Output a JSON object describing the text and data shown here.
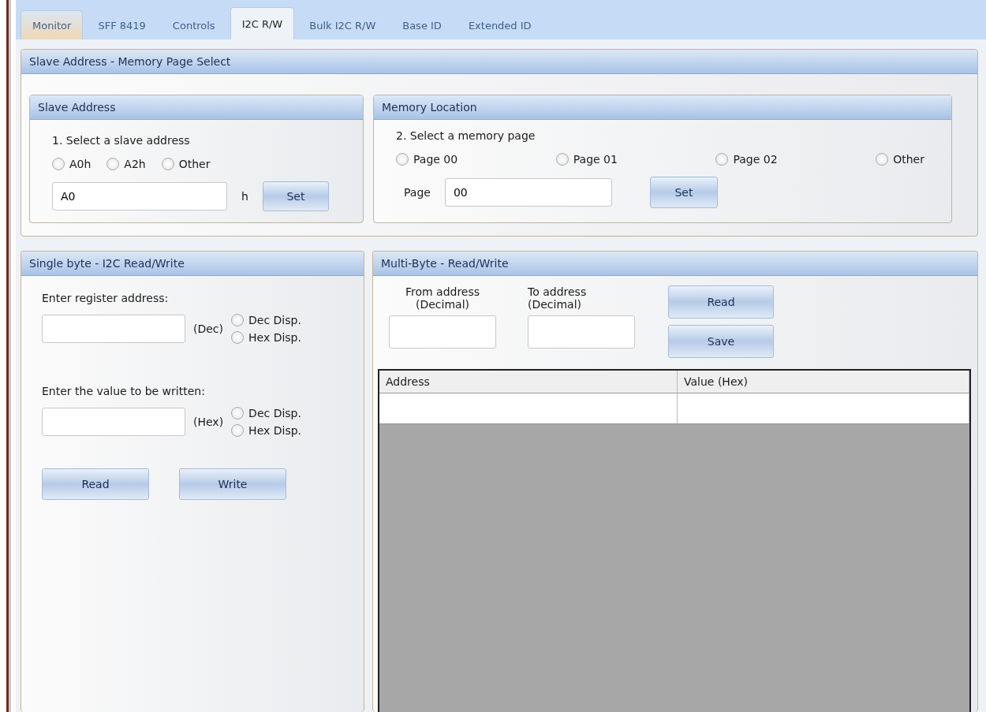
{
  "tabs": [
    {
      "label": "Monitor",
      "selected": false,
      "hovered": true
    },
    {
      "label": "SFF 8419",
      "selected": false,
      "hovered": false
    },
    {
      "label": "Controls",
      "selected": false,
      "hovered": false
    },
    {
      "label": "I2C R/W",
      "selected": true,
      "hovered": false
    },
    {
      "label": "Bulk I2C R/W",
      "selected": false,
      "hovered": false
    },
    {
      "label": "Base ID",
      "selected": false,
      "hovered": false
    },
    {
      "label": "Extended ID",
      "selected": false,
      "hovered": false
    }
  ],
  "main_group": {
    "title": "Slave Address - Memory Page Select",
    "slave_address": {
      "title": "Slave Address",
      "instruction": "1. Select a slave address",
      "options": [
        {
          "label": "A0h",
          "checked": false
        },
        {
          "label": "A2h",
          "checked": false
        },
        {
          "label": "Other",
          "checked": false
        }
      ],
      "value": "A0",
      "suffix": "h",
      "button": "Set"
    },
    "memory_location": {
      "title": "Memory Location",
      "instruction": "2. Select a memory page",
      "options": [
        {
          "label": "Page 00",
          "checked": false
        },
        {
          "label": "Page 01",
          "checked": false
        },
        {
          "label": "Page 02",
          "checked": false
        },
        {
          "label": "Other",
          "checked": false
        }
      ],
      "field_label": "Page",
      "value": "00",
      "button": "Set"
    }
  },
  "single_byte": {
    "title": "Single byte - I2C Read/Write",
    "sections": [
      {
        "label": "Enter register address:",
        "unit": "(Dec)",
        "options": [
          {
            "label": "Dec Disp.",
            "checked": false
          },
          {
            "label": "Hex Disp.",
            "checked": false
          }
        ]
      },
      {
        "label": "Enter the value to be written:",
        "unit": "(Hex)",
        "options": [
          {
            "label": "Dec Disp.",
            "checked": false
          },
          {
            "label": "Hex Disp.",
            "checked": false
          }
        ]
      }
    ],
    "buttons": [
      "Read",
      "Write"
    ]
  },
  "multi_byte": {
    "title": "Multi-Byte - Read/Write",
    "from_label": "From address\n(Decimal)",
    "to_label": "To address\n(Decimal)",
    "buttons": [
      "Read",
      "Save"
    ],
    "table": {
      "columns": [
        "Address",
        "Value (Hex)"
      ]
    }
  }
}
